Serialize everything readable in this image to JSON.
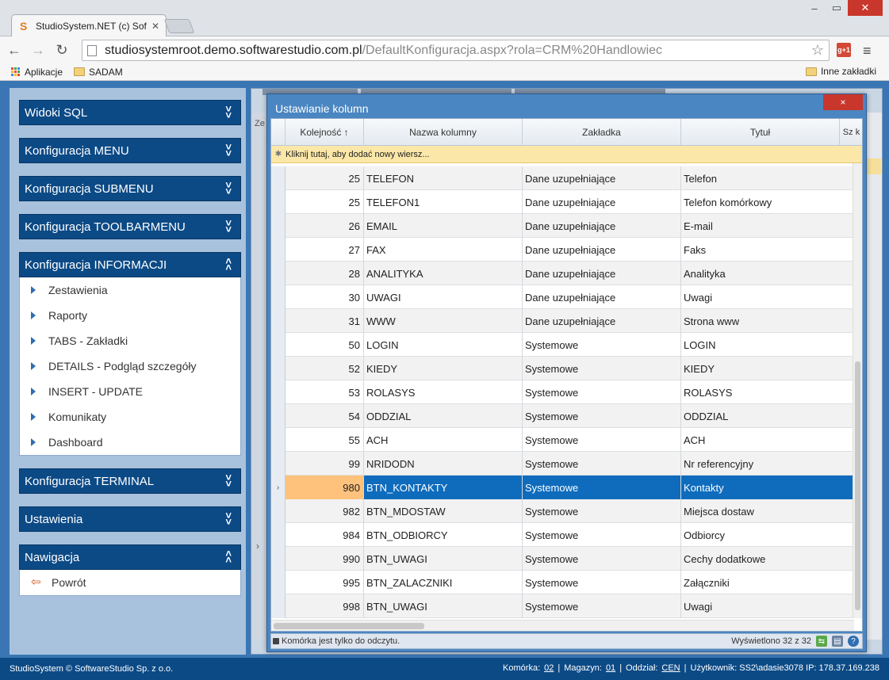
{
  "browser": {
    "tab_title": "StudioSystem.NET (c) Soft",
    "url_host": "studiosystemroot.demo.softwarestudio.com.pl",
    "url_path": "/DefaultKonfiguracja.aspx?rola=CRM%20Handlowiec",
    "gplus_label": "g+1",
    "bookmarks": {
      "apps": "Aplikacje",
      "folder1": "SADAM",
      "other": "Inne zakładki"
    }
  },
  "sidebar": {
    "sections": [
      {
        "title": "Widoki SQL",
        "state": "collapsed"
      },
      {
        "title": "Konfiguracja MENU",
        "state": "collapsed"
      },
      {
        "title": "Konfiguracja SUBMENU",
        "state": "collapsed"
      },
      {
        "title": "Konfiguracja TOOLBARMENU",
        "state": "collapsed"
      },
      {
        "title": "Konfiguracja INFORMACJI",
        "state": "expanded",
        "items": [
          "Zestawienia",
          "Raporty",
          "TABS - Zakładki",
          "DETAILS - Podgląd szczegóły",
          "INSERT - UPDATE",
          "Komunikaty",
          "Dashboard"
        ]
      },
      {
        "title": "Konfiguracja TERMINAL",
        "state": "collapsed"
      },
      {
        "title": "Ustawienia",
        "state": "collapsed"
      },
      {
        "title": "Nawigacja",
        "state": "expanded",
        "items": [
          "Powrót"
        ]
      }
    ]
  },
  "background": {
    "column_fragment": "Ze"
  },
  "dialog": {
    "title": "Ustawianie kolumn",
    "close_glyph": "×",
    "columns": [
      "Kolejność ↑",
      "Nazwa kolumny",
      "Zakładka",
      "Tytuł",
      "Sz k"
    ],
    "new_row_text": "Kliknij tutaj, aby dodać nowy wiersz...",
    "rows": [
      {
        "order": "25",
        "name": "TELEFON",
        "tab": "Dane uzupełniające",
        "title": "Telefon"
      },
      {
        "order": "25",
        "name": "TELEFON1",
        "tab": "Dane uzupełniające",
        "title": "Telefon komórkowy"
      },
      {
        "order": "26",
        "name": "EMAIL",
        "tab": "Dane uzupełniające",
        "title": "E-mail"
      },
      {
        "order": "27",
        "name": "FAX",
        "tab": "Dane uzupełniające",
        "title": "Faks"
      },
      {
        "order": "28",
        "name": "ANALITYKA",
        "tab": "Dane uzupełniające",
        "title": "Analityka"
      },
      {
        "order": "30",
        "name": "UWAGI",
        "tab": "Dane uzupełniające",
        "title": "Uwagi"
      },
      {
        "order": "31",
        "name": "WWW",
        "tab": "Dane uzupełniające",
        "title": "Strona www"
      },
      {
        "order": "50",
        "name": "LOGIN",
        "tab": "Systemowe",
        "title": "LOGIN"
      },
      {
        "order": "52",
        "name": "KIEDY",
        "tab": "Systemowe",
        "title": "KIEDY"
      },
      {
        "order": "53",
        "name": "ROLASYS",
        "tab": "Systemowe",
        "title": "ROLASYS"
      },
      {
        "order": "54",
        "name": "ODDZIAL",
        "tab": "Systemowe",
        "title": "ODDZIAL"
      },
      {
        "order": "55",
        "name": "ACH",
        "tab": "Systemowe",
        "title": "ACH"
      },
      {
        "order": "99",
        "name": "NRIDODN",
        "tab": "Systemowe",
        "title": "Nr referencyjny"
      },
      {
        "order": "980",
        "name": "BTN_KONTAKTY",
        "tab": "Systemowe",
        "title": "Kontakty",
        "selected": true
      },
      {
        "order": "982",
        "name": "BTN_MDOSTAW",
        "tab": "Systemowe",
        "title": "Miejsca dostaw"
      },
      {
        "order": "984",
        "name": "BTN_ODBIORCY",
        "tab": "Systemowe",
        "title": "Odbiorcy"
      },
      {
        "order": "990",
        "name": "BTN_UWAGI",
        "tab": "Systemowe",
        "title": "Cechy dodatkowe"
      },
      {
        "order": "995",
        "name": "BTN_ZALACZNIKI",
        "tab": "Systemowe",
        "title": "Załączniki"
      },
      {
        "order": "998",
        "name": "BTN_UWAGI",
        "tab": "Systemowe",
        "title": "Uwagi"
      }
    ],
    "status_left": "Komórka jest tylko do odczytu.",
    "status_right": "Wyświetlono 32 z 32"
  },
  "status_bar": {
    "left": "StudioSystem © SoftwareStudio Sp. z o.o.",
    "komorka_label": "Komórka:",
    "komorka_value": "02",
    "magazyn_label": "Magazyn:",
    "magazyn_value": "01",
    "oddzial_label": "Oddział:",
    "oddzial_value": "CEN",
    "user": "Użytkownik: SS2\\adasie3078 IP: 178.37.169.238"
  }
}
